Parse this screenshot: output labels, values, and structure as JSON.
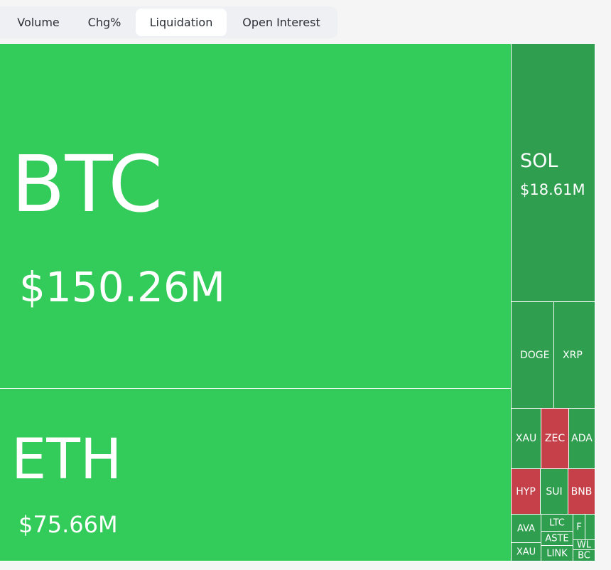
{
  "tabs": [
    {
      "label": "Volume"
    },
    {
      "label": "Chg%"
    },
    {
      "label": "Liquidation",
      "active": true
    },
    {
      "label": "Open Interest"
    }
  ],
  "colors": {
    "bright_green": "#33cc5a",
    "mid_green": "#2f9e4f",
    "red": "#c6404a"
  },
  "cells": {
    "btc": {
      "symbol": "BTC",
      "value": "$150.26M"
    },
    "eth": {
      "symbol": "ETH",
      "value": "$75.66M"
    },
    "sol": {
      "symbol": "SOL",
      "value": "$18.61M"
    },
    "doge": {
      "symbol": "DOGE"
    },
    "xrp": {
      "symbol": "XRP"
    },
    "xau1": {
      "symbol": "XAU"
    },
    "zec": {
      "symbol": "ZEC"
    },
    "ada": {
      "symbol": "ADA"
    },
    "hype": {
      "symbol": "HYP"
    },
    "sui": {
      "symbol": "SUI"
    },
    "bnb": {
      "symbol": "BNB"
    },
    "ava": {
      "symbol": "AVA"
    },
    "ltc": {
      "symbol": "LTC"
    },
    "aster": {
      "symbol": "ASTE"
    },
    "xau2": {
      "symbol": "XAU"
    },
    "link": {
      "symbol": "LINK"
    },
    "f": {
      "symbol": "F"
    },
    "wl": {
      "symbol": "WL"
    },
    "bc": {
      "symbol": "BC"
    }
  }
}
